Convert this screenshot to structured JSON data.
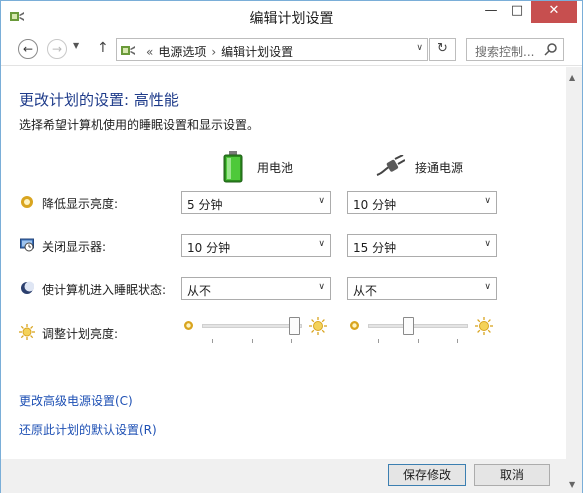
{
  "window": {
    "title": "编辑计划设置",
    "minimize": "—",
    "maximize": "□",
    "close": "✕"
  },
  "nav": {
    "back": "←",
    "forward": "→",
    "recent": "▼",
    "up": "↑",
    "breadcrumb": [
      "«",
      "电源选项",
      "›",
      "编辑计划设置"
    ],
    "address_dropdown": "∨",
    "refresh": "↻",
    "search_placeholder": "搜索控制..."
  },
  "content": {
    "heading": "更改计划的设置: 高性能",
    "subheading": "选择希望计算机使用的睡眠设置和显示设置。",
    "columns": {
      "battery": "用电池",
      "plugged": "接通电源"
    },
    "rows": [
      {
        "label": "降低显示亮度:",
        "icon": "brightness-dim-icon",
        "battery": "5 分钟",
        "plugged": "10 分钟"
      },
      {
        "label": "关闭显示器:",
        "icon": "monitor-off-icon",
        "battery": "10 分钟",
        "plugged": "15 分钟"
      },
      {
        "label": "使计算机进入睡眠状态:",
        "icon": "sleep-moon-icon",
        "battery": "从不",
        "plugged": "从不"
      }
    ],
    "brightness": {
      "label": "调整计划亮度:",
      "icon": "sun-icon",
      "battery_level": 0.92,
      "plugged_level": 0.4
    },
    "links": {
      "advanced": "更改高级电源设置(C)",
      "restore": "还原此计划的默认设置(R)"
    },
    "select_arrow": "∨"
  },
  "footer": {
    "save": "保存修改",
    "cancel": "取消"
  },
  "scrollbar": {
    "up": "▲",
    "down": "▼"
  },
  "colors": {
    "heading": "#1e3b8a",
    "link": "#1e50b4",
    "close_button": "#c74f4f",
    "battery_green": "#3fae2a"
  }
}
